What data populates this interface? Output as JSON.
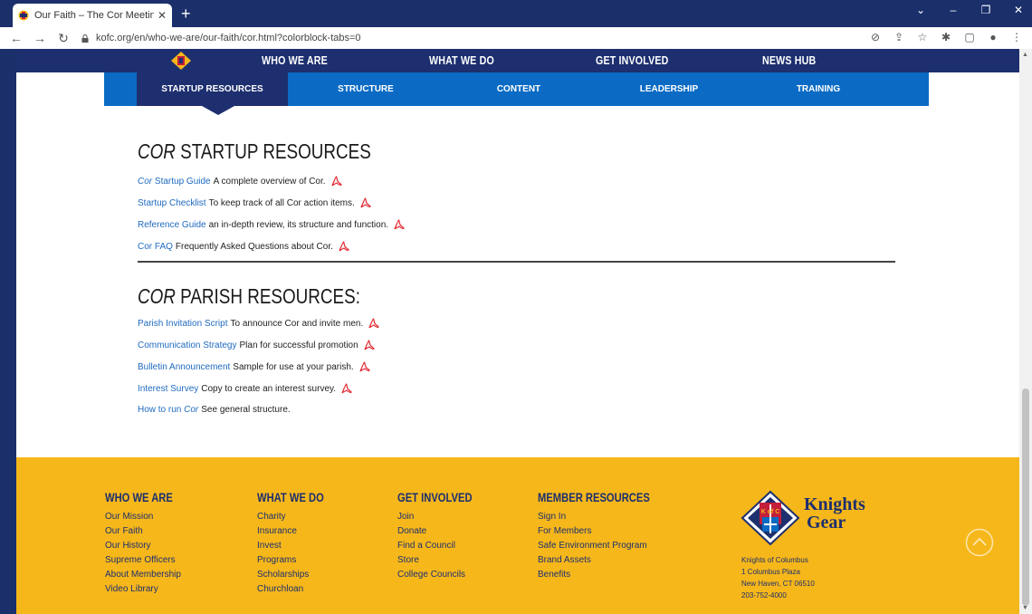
{
  "browser": {
    "tab_title": "Our Faith – The Cor Meeting | Kn",
    "new_tab": "+",
    "url": "kofc.org/en/who-we-are/our-faith/cor.html?colorblock-tabs=0"
  },
  "nav": {
    "main": [
      "WHO WE ARE",
      "WHAT WE DO",
      "GET INVOLVED",
      "NEWS HUB"
    ],
    "sub": [
      "STARTUP RESOURCES",
      "STRUCTURE",
      "CONTENT",
      "LEADERSHIP",
      "TRAINING"
    ]
  },
  "startup": {
    "title_em": "COR",
    "title_rest": " STARTUP RESOURCES",
    "items": [
      {
        "link": "Cor Startup Guide",
        "link_em": "Cor",
        "link_rest": " Startup Guide",
        "text": "A complete overview of Cor."
      },
      {
        "link": "Startup Checklist",
        "text": "To keep track of all Cor action items."
      },
      {
        "link": "Reference Guide",
        "text": "an in-depth review, its structure and function."
      },
      {
        "link": "Cor FAQ",
        "text": "Frequently Asked Questions about Cor."
      }
    ]
  },
  "parish": {
    "title_em": "COR",
    "title_rest": " PARISH RESOURCES:",
    "items": [
      {
        "link": "Parish Invitation Script",
        "text": "To announce Cor and invite men."
      },
      {
        "link": "Communication Strategy",
        "text": "Plan for successful promotion"
      },
      {
        "link": "Bulletin Announcement",
        "text": "Sample for use at your parish."
      },
      {
        "link": "Interest Survey",
        "text": "Copy to create an interest survey."
      },
      {
        "link_plain": "How to run ",
        "link_em": "Cor",
        "text": "See general structure."
      }
    ]
  },
  "footer": {
    "columns": [
      {
        "heading": "WHO WE ARE",
        "links": [
          "Our Mission",
          "Our Faith",
          "Our History",
          "Supreme Officers",
          "About Membership",
          "Video Library"
        ]
      },
      {
        "heading": "WHAT WE DO",
        "links": [
          "Charity",
          "Insurance",
          "Invest",
          "Programs",
          "Scholarships",
          "Churchloan"
        ]
      },
      {
        "heading": "GET INVOLVED",
        "links": [
          "Join",
          "Donate",
          "Find a Council",
          "Store",
          "College Councils"
        ]
      },
      {
        "heading": "MEMBER RESOURCES",
        "links": [
          "Sign In",
          "For Members",
          "Safe Environment Program",
          "Brand Assets",
          "Benefits"
        ]
      }
    ],
    "brand_line1": "Knights",
    "brand_line2": "Gear",
    "emblem_text": "K of C",
    "address": [
      "Knights of Columbus",
      "1 Columbus Plaza",
      "New Haven, CT 06510",
      "203-752-4000"
    ]
  },
  "colors": {
    "navy": "#1d2f6e",
    "blue": "#0b6bc4",
    "gold": "#f6b71b",
    "link": "#1f6ac0",
    "pdf_red": "#e0242b"
  }
}
